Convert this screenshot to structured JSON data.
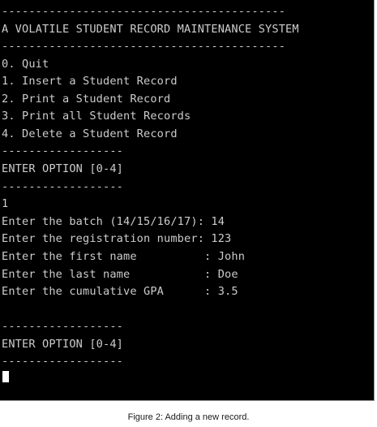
{
  "terminal": {
    "lines": [
      "------------------------------------------",
      "A VOLATILE STUDENT RECORD MAINTENANCE SYSTEM",
      "------------------------------------------",
      "0. Quit",
      "1. Insert a Student Record",
      "2. Print a Student Record",
      "3. Print all Student Records",
      "4. Delete a Student Record",
      "------------------",
      "ENTER OPTION [0-4]",
      "------------------",
      "",
      "1",
      "Enter the batch (14/15/16/17): 14",
      "Enter the registration number: 123",
      "Enter the first name          : John",
      "Enter the last name           : Doe",
      "Enter the cumulative GPA      : 3.5",
      "",
      "------------------",
      "ENTER OPTION [0-4]",
      "------------------"
    ]
  },
  "caption": "Figure 2: Adding a new record."
}
